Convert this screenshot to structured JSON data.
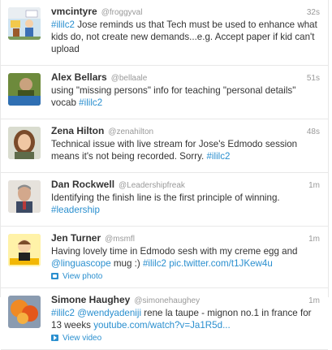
{
  "colors": {
    "link": "#2a8fcf",
    "text": "#333333",
    "muted": "#999999",
    "divider": "#e8e8e8"
  },
  "tweets": [
    {
      "avatar_icon": "cartoon-classroom-avatar",
      "name": "vmcintyre",
      "handle": "@froggyval",
      "time": "32s",
      "segments": [
        {
          "text": "#ililc2",
          "link": true
        },
        {
          "text": " Jose reminds us that Tech must be used to enhance what kids do, not create new demands...e.g. Accept paper if kid can't upload",
          "link": false
        }
      ]
    },
    {
      "avatar_icon": "isleep-avatar",
      "name": "Alex Bellars",
      "handle": "@bellaale",
      "time": "51s",
      "segments": [
        {
          "text": "using \"missing persons\" info for teaching \"personal details\" vocab ",
          "link": false
        },
        {
          "text": "#ililc2",
          "link": true
        }
      ]
    },
    {
      "avatar_icon": "woman-photo-avatar",
      "name": "Zena Hilton",
      "handle": "@zenahilton",
      "time": "48s",
      "segments": [
        {
          "text": "Technical issue with live stream for Jose's Edmodo session means it's not being recorded. Sorry. ",
          "link": false
        },
        {
          "text": "#ililc2",
          "link": true
        }
      ]
    },
    {
      "avatar_icon": "man-photo-avatar",
      "name": "Dan Rockwell",
      "handle": "@Leadershipfreak",
      "time": "1m",
      "segments": [
        {
          "text": "Identifying the finish line is the first principle of winning. ",
          "link": false
        },
        {
          "text": "#leadership",
          "link": true
        }
      ]
    },
    {
      "avatar_icon": "cartoon-yellow-avatar",
      "name": "Jen Turner",
      "handle": "@msmfl",
      "time": "1m",
      "segments": [
        {
          "text": "Having lovely time in Edmodo sesh with my creme egg and ",
          "link": false
        },
        {
          "text": "@linguascope",
          "link": true
        },
        {
          "text": " mug :) ",
          "link": false
        },
        {
          "text": "#ililc2",
          "link": true
        },
        {
          "text": " ",
          "link": false
        },
        {
          "text": "pic.twitter.com/t1JKew4u",
          "link": true
        }
      ],
      "media": {
        "label": "View photo",
        "icon": "photo-icon"
      }
    },
    {
      "avatar_icon": "orange-photo-avatar",
      "name": "Simone Haughey",
      "handle": "@simonehaughey",
      "time": "1m",
      "segments": [
        {
          "text": "#ililc2",
          "link": true
        },
        {
          "text": " ",
          "link": false
        },
        {
          "text": "@wendyadeniji",
          "link": true
        },
        {
          "text": " rene la taupe - mignon no.1 in france for 13 weeks ",
          "link": false
        },
        {
          "text": "youtube.com/watch?v=Ja1R5d...",
          "link": true
        }
      ],
      "media": {
        "label": "View video",
        "icon": "video-icon"
      }
    }
  ]
}
